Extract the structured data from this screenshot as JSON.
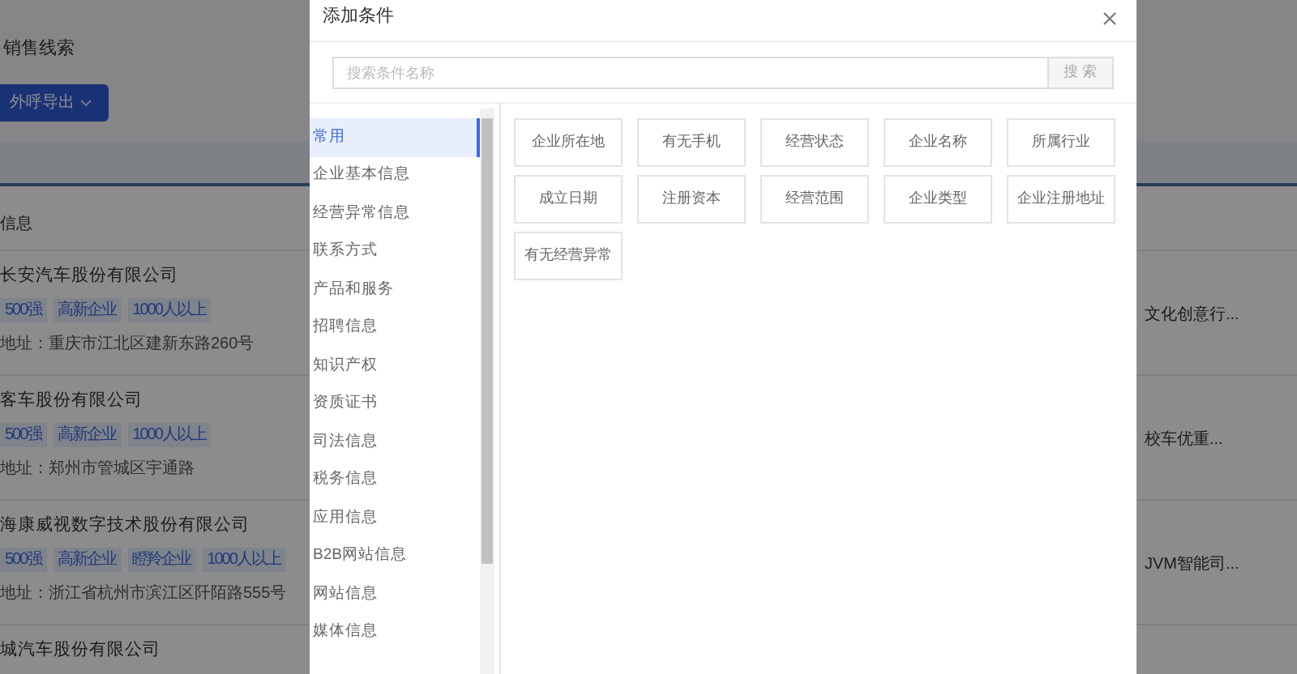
{
  "page": {
    "title": "销售线索",
    "export_button": "外呼导出",
    "column_header": "信息",
    "companies": [
      {
        "name": "长安汽车股份有限公司",
        "tags": [
          "500强",
          "高新企业",
          "1000人以上"
        ],
        "address": "地址：重庆市江北区建新东路260号",
        "side_text": "文化创意行..."
      },
      {
        "name": "客车股份有限公司",
        "tags": [
          "500强",
          "高新企业",
          "1000人以上"
        ],
        "address": "地址：郑州市管城区宇通路",
        "side_text": "校车优重..."
      },
      {
        "name": "海康威视数字技术股份有限公司",
        "tags": [
          "500强",
          "高新企业",
          "瞪羚企业",
          "1000人以上"
        ],
        "address": "地址：浙江省杭州市滨江区阡陌路555号",
        "side_text": "JVM智能司..."
      },
      {
        "name": "城汽车股份有限公司"
      }
    ]
  },
  "dialog": {
    "title": "添加条件",
    "search": {
      "placeholder": "搜索条件名称"
    },
    "search_button": "搜 索",
    "categories": [
      {
        "label": "常用",
        "selected": true
      },
      {
        "label": "企业基本信息",
        "selected": false
      },
      {
        "label": "经营异常信息",
        "selected": false
      },
      {
        "label": "联系方式",
        "selected": false
      },
      {
        "label": "产品和服务",
        "selected": false
      },
      {
        "label": "招聘信息",
        "selected": false
      },
      {
        "label": "知识产权",
        "selected": false
      },
      {
        "label": "资质证书",
        "selected": false
      },
      {
        "label": "司法信息",
        "selected": false
      },
      {
        "label": "税务信息",
        "selected": false
      },
      {
        "label": "应用信息",
        "selected": false
      },
      {
        "label": "B2B网站信息",
        "selected": false
      },
      {
        "label": "网站信息",
        "selected": false
      },
      {
        "label": "媒体信息",
        "selected": false
      }
    ],
    "conditions": [
      "企业所在地",
      "有无手机",
      "经营状态",
      "企业名称",
      "所属行业",
      "成立日期",
      "注册资本",
      "经营范围",
      "企业类型",
      "企业注册地址",
      "有无经营异常"
    ]
  }
}
